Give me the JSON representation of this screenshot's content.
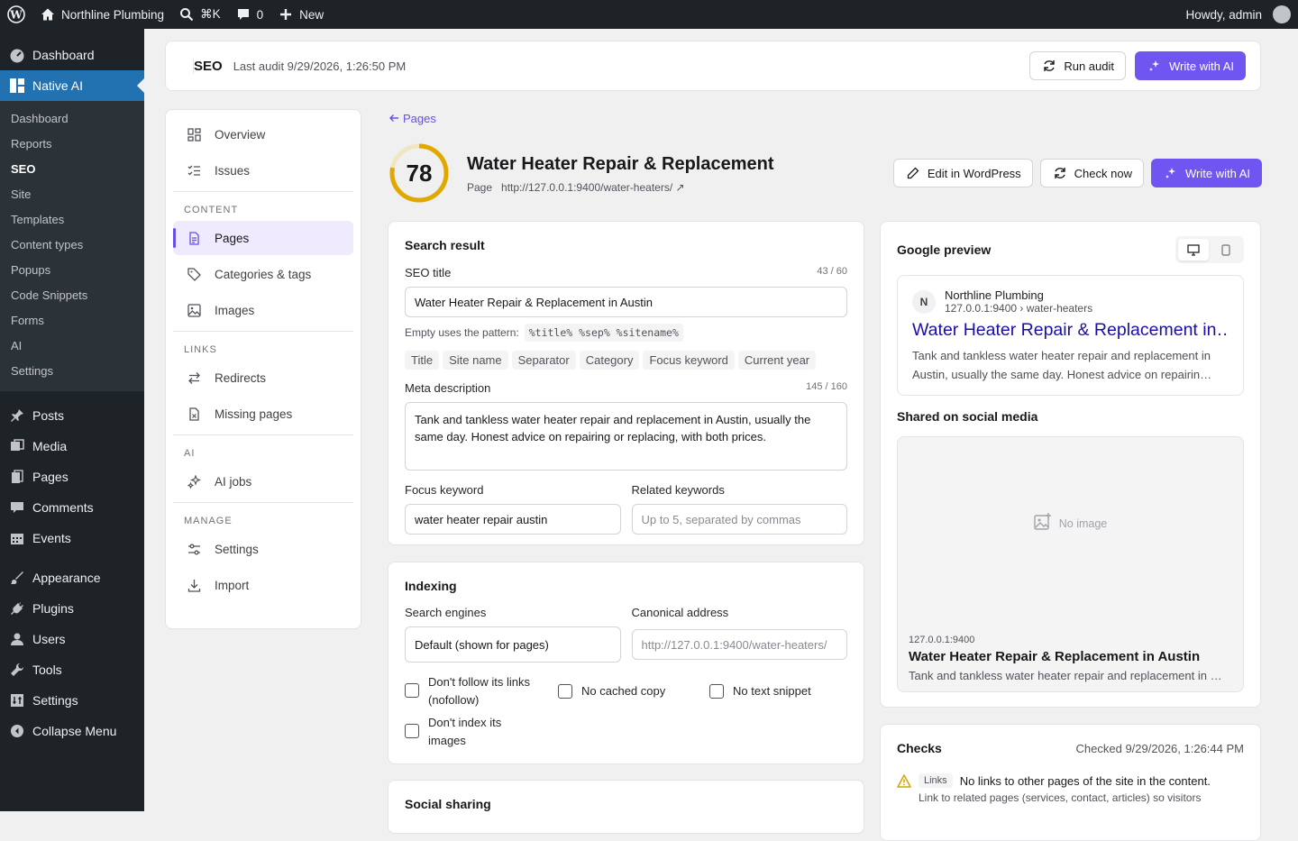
{
  "adminbar": {
    "site_name": "Northline Plumbing",
    "search_shortcut": "⌘K",
    "comments_count": "0",
    "new_label": "New",
    "greeting": "Howdy, admin"
  },
  "wp_menu": {
    "dashboard": "Dashboard",
    "native_ai": "Native AI",
    "submenu": [
      "Dashboard",
      "Reports",
      "SEO",
      "Site",
      "Templates",
      "Content types",
      "Popups",
      "Code Snippets",
      "Forms",
      "AI",
      "Settings"
    ],
    "items": [
      "Posts",
      "Media",
      "Pages",
      "Comments",
      "Events",
      "Appearance",
      "Plugins",
      "Users",
      "Tools",
      "Settings",
      "Collapse Menu"
    ]
  },
  "topbar": {
    "title": "SEO",
    "last_audit": "Last audit 9/29/2026, 1:26:50 PM",
    "run_audit": "Run audit",
    "write_ai": "Write with AI"
  },
  "nav": {
    "overview": "Overview",
    "issues": "Issues",
    "content_heading": "CONTENT",
    "pages": "Pages",
    "categories": "Categories & tags",
    "images": "Images",
    "links_heading": "LINKS",
    "redirects": "Redirects",
    "missing": "Missing pages",
    "ai_heading": "AI",
    "ai_jobs": "AI jobs",
    "manage_heading": "MANAGE",
    "settings": "Settings",
    "import": "Import"
  },
  "page": {
    "back": "Pages",
    "score": "78",
    "score_fraction": 0.78,
    "title": "Water Heater Repair & Replacement",
    "type": "Page",
    "url": "http://127.0.0.1:9400/water-heaters/",
    "edit_wp": "Edit in WordPress",
    "check_now": "Check now",
    "write_ai": "Write with AI"
  },
  "search_result": {
    "heading": "Search result",
    "seo_title_label": "SEO title",
    "seo_title_count": "43 / 60",
    "seo_title_value": "Water Heater Repair & Replacement in Austin",
    "pattern_label": "Empty uses the pattern:",
    "pattern": "%title% %sep% %sitename%",
    "chips": [
      "Title",
      "Site name",
      "Separator",
      "Category",
      "Focus keyword",
      "Current year"
    ],
    "meta_label": "Meta description",
    "meta_count": "145 / 160",
    "meta_value": "Tank and tankless water heater repair and replacement in Austin, usually the same day. Honest advice on repairing or replacing, with both prices.",
    "focus_label": "Focus keyword",
    "focus_value": "water heater repair austin",
    "related_label": "Related keywords",
    "related_placeholder": "Up to 5, separated by commas"
  },
  "indexing": {
    "heading": "Indexing",
    "engines_label": "Search engines",
    "engines_value": "Default (shown for pages)",
    "canonical_label": "Canonical address",
    "canonical_placeholder": "http://127.0.0.1:9400/water-heaters/",
    "nofollow_line1": "Don't follow its links",
    "nofollow_line2": "(nofollow)",
    "nocache": "No cached copy",
    "nosnippet": "No text snippet",
    "noimageindex_line1": "Don't index its",
    "noimageindex_line2": "images"
  },
  "social": {
    "heading": "Social sharing"
  },
  "google": {
    "heading": "Google preview",
    "avatar_letter": "N",
    "site": "Northline Plumbing",
    "path": "127.0.0.1:9400 › water-heaters",
    "title": "Water Heater Repair & Replacement in…",
    "desc": "Tank and tankless water heater repair and replacement in Austin, usually the same day. Honest advice on repairin…"
  },
  "shared": {
    "heading": "Shared on social media",
    "no_image": "No image",
    "domain": "127.0.0.1:9400",
    "title": "Water Heater Repair & Replacement in Austin",
    "desc": "Tank and tankless water heater repair and replacement in …"
  },
  "checks": {
    "heading": "Checks",
    "checked": "Checked 9/29/2026, 1:26:44 PM",
    "tag": "Links",
    "message": "No links to other pages of the site in the content.",
    "hint": "Link to related pages (services, contact, articles) so visitors"
  },
  "colors": {
    "accent": "#7055f0",
    "score_ring": "#e0a800",
    "wp_blue": "#2271b1",
    "admin_dark": "#1d2327"
  }
}
